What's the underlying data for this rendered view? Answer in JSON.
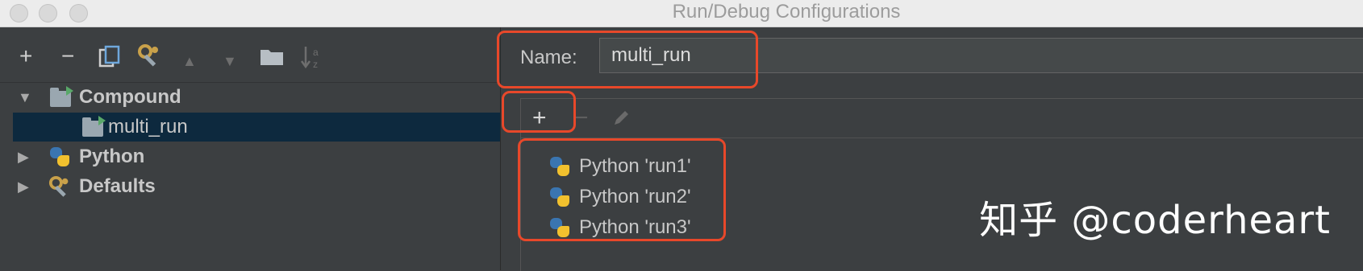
{
  "window": {
    "title": "Run/Debug Configurations"
  },
  "left_toolbar": {
    "add": "+",
    "remove": "−",
    "up": "▲",
    "down": "▼",
    "sort": "↓"
  },
  "tree": {
    "compound": {
      "label": "Compound",
      "expanded": true
    },
    "compound_child": {
      "label": "multi_run",
      "selected": true
    },
    "python": {
      "label": "Python",
      "expanded": false
    },
    "defaults": {
      "label": "Defaults",
      "expanded": false
    }
  },
  "config": {
    "name_label": "Name:",
    "name_value": "multi_run",
    "add": "+",
    "remove": "−",
    "items": [
      "Python 'run1'",
      "Python 'run2'",
      "Python 'run3'"
    ]
  },
  "watermark": "知乎 @coderheart",
  "colors": {
    "highlight": "#e8482a",
    "selection": "#0d293e",
    "background": "#3c3f41"
  },
  "icons": [
    "copy-icon",
    "wrench-icon",
    "folder-icon",
    "sort-icon",
    "python-icon",
    "edit-icon"
  ]
}
